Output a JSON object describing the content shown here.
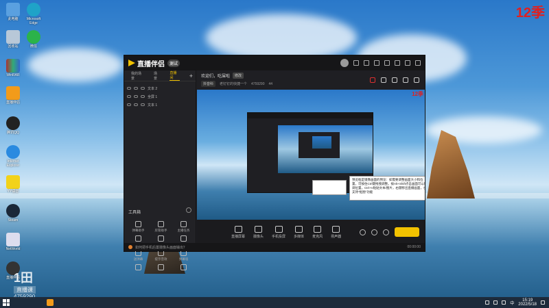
{
  "desktop": {
    "corner_tag": "12季",
    "icons": [
      {
        "label": "此电脑",
        "icon": "computer-icon"
      },
      {
        "label": "Microsoft Edge",
        "icon": "edge-icon"
      },
      {
        "label": "回收站",
        "icon": "recycle-bin-icon"
      },
      {
        "label": "微信",
        "icon": "wechat-icon"
      },
      {
        "label": "WinRAR",
        "icon": "winrar-icon"
      },
      {
        "label": "直播伴侣",
        "icon": "douyin-companion-icon"
      },
      {
        "label": "腾讯QQ",
        "icon": "qq-icon"
      },
      {
        "label": "Internet Explorer",
        "icon": "ie-icon"
      },
      {
        "label": "YY语音",
        "icon": "yy-icon"
      },
      {
        "label": "Steam",
        "icon": "steam-icon"
      },
      {
        "label": "NetWorld",
        "icon": "network-icon"
      },
      {
        "label": "直播伴侣",
        "icon": "obs-icon"
      }
    ],
    "watermark": {
      "big": "1田",
      "small": "直播课",
      "id": "4759290"
    }
  },
  "app": {
    "logo": "直播伴侣",
    "version_tag": "测试",
    "tabs": [
      "我的场景",
      "场景",
      "直播间"
    ],
    "active_tab": 2,
    "layers": [
      {
        "name": "文本 2"
      },
      {
        "name": "全屏 1"
      },
      {
        "name": "文本 1"
      }
    ],
    "tools_title": "工具箱",
    "tools": [
      {
        "label": "弹幕助手",
        "icon": "danmaku-icon"
      },
      {
        "label": "房管助手",
        "icon": "admin-icon"
      },
      {
        "label": "主播任务",
        "icon": "task-icon"
      },
      {
        "label": "抖音连麦",
        "icon": "link-icon"
      },
      {
        "label": "本人设置",
        "icon": "download-icon"
      },
      {
        "label": "背景音乐",
        "icon": "music-icon"
      },
      {
        "label": "送弹幕",
        "icon": "send-icon"
      },
      {
        "label": "提示音效",
        "icon": "download-icon"
      },
      {
        "label": "弹幕墙",
        "icon": "wall-icon"
      },
      {
        "label": "",
        "icon": "calc-icon"
      },
      {
        "label": "",
        "icon": "gamepad-icon"
      },
      {
        "label": "",
        "icon": "download-icon"
      }
    ],
    "stream_title": "欢迎们，吃屎啦",
    "edit_label": "修改",
    "category": "抖音科",
    "meta_text": "老钉钉的快捷一个",
    "viewer_id": "4759290",
    "likes": "44",
    "preview_tag": "12季",
    "tooltip": "预览框是镜像画面的预览：如需要调整画面大小和位置，可按住Ctrl键拖拽调整。按Alt+Shift点击画面可以微调位置，Ctrl+V粘贴文本/图片，右键移出直播画面，也支持\"抠图\"功能",
    "controls": [
      {
        "label": "直播屏幕",
        "icon": "screen-icon"
      },
      {
        "label": "摄像头",
        "icon": "camera-icon"
      },
      {
        "label": "手机投屏",
        "icon": "phone-icon"
      },
      {
        "label": "多媒体",
        "icon": "media-icon"
      },
      {
        "label": "麦克风",
        "icon": "mic-icon"
      },
      {
        "label": "扬声器",
        "icon": "speaker-icon"
      }
    ],
    "status_text": "如何把手机后置摄像头画面输出？",
    "status_time": "00:00:00"
  },
  "taskbar": {
    "time": "15:19",
    "date": "2022/5/18",
    "lang": "中"
  }
}
